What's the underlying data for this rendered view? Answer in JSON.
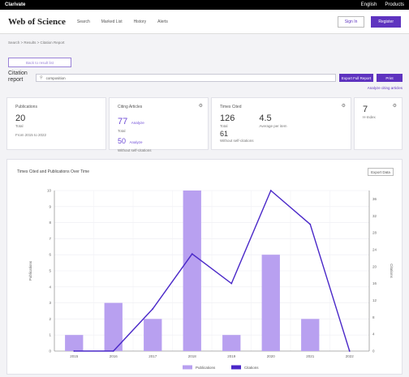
{
  "topbar": {
    "brand": "Clarivate",
    "english": "English",
    "products": "Products"
  },
  "navbar": {
    "logo": "Web of Science",
    "links": [
      "Search",
      "Marked List",
      "History",
      "Alerts"
    ],
    "sign_in": "Sign In",
    "register": "Register"
  },
  "breadcrumb": "Search > Results > Citation Report",
  "back_button": "Back to result list",
  "report_title": "Citation report",
  "search": {
    "query": "composition"
  },
  "buttons": {
    "export": "Export Full Report",
    "print": "Print"
  },
  "analyze_link": "Analyze citing articles",
  "cards": {
    "publications": {
      "title": "Publications",
      "value": "20",
      "sub": "Total",
      "range": "From 2015 to 2022"
    },
    "citing": {
      "title": "Citing Articles",
      "v1": "77",
      "v1_link": "Analyze",
      "l1": "Total",
      "v2": "50",
      "v2_link": "Analyze",
      "l2": "Without self-citations"
    },
    "times_cited": {
      "title": "Times Cited",
      "v1": "126",
      "l1": "Total",
      "v2": "4.5",
      "l2": "Average per item",
      "v3": "61",
      "l3": "Without self-citations"
    },
    "h_index": {
      "value": "7",
      "label": "H-Index"
    }
  },
  "chart_title": "Times Cited and Publications Over Time",
  "export_data": "Export Data",
  "colors": {
    "accent": "#5e33bf",
    "bar": "#b8a0f0",
    "line": "#4a28c8"
  },
  "chart_data": {
    "type": "bar",
    "categories": [
      "2015",
      "2016",
      "2017",
      "2018",
      "2019",
      "2020",
      "2021",
      "2022"
    ],
    "series": [
      {
        "name": "Publications",
        "type": "bar",
        "axis": "left",
        "values": [
          1,
          3,
          2,
          10,
          1,
          6,
          2,
          0
        ]
      },
      {
        "name": "Citations",
        "type": "line",
        "axis": "right",
        "values": [
          0,
          0,
          10,
          23,
          16,
          38,
          30,
          0
        ]
      }
    ],
    "ylim_left": [
      0,
      10
    ],
    "ylim_right": [
      0,
      38
    ],
    "yticks_left": [
      "0",
      "1",
      "2",
      "3",
      "4",
      "5",
      "6",
      "7",
      "8",
      "9",
      "10"
    ],
    "yticks_right": [
      "0",
      "4",
      "8",
      "12",
      "16",
      "20",
      "24",
      "28",
      "32",
      "36"
    ],
    "ylabel_left": "Publications",
    "ylabel_right": "Citations",
    "legend": [
      "Publications",
      "Citations"
    ],
    "legend_position": "bottom"
  }
}
